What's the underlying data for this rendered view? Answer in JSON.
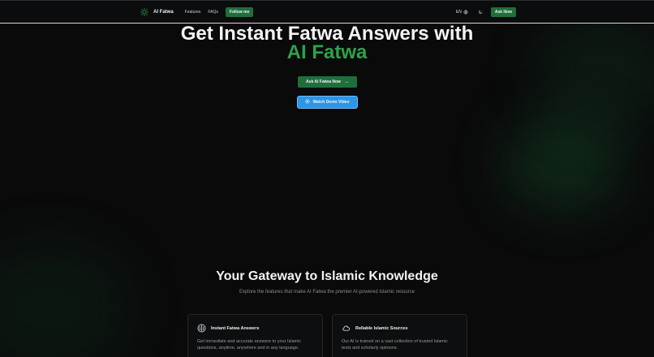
{
  "navbar": {
    "brand": "AI Fatwa",
    "links": [
      "Features",
      "FAQs"
    ],
    "follow_label": "Follow me",
    "lang": "EN",
    "ask_label": "Ask Now"
  },
  "hero": {
    "title_line1": "Get Instant Fatwa Answers with",
    "title_line2": "AI Fatwa",
    "primary_label": "Ask AI Fatwa Now",
    "demo_label": "Watch Demo Video"
  },
  "section": {
    "title": "Your Gateway to Islamic Knowledge",
    "subtitle": "Explore the features that make AI Fatwa the premier AI-powered Islamic resource",
    "cards": [
      {
        "title": "Instant Fatwa Answers",
        "desc": "Get immediate and accurate answers to your Islamic questions, anytime, anywhere and in any language.",
        "icon": "brain-icon"
      },
      {
        "title": "Reliable Islamic Sources",
        "desc": "Our AI is trained on a vast collection of trusted Islamic texts and scholarly opinions.",
        "icon": "cloud-icon"
      }
    ]
  },
  "colors": {
    "accent_green": "#1f6f3c",
    "title_green": "#2ca24a",
    "demo_blue": "#2b95e8",
    "background": "#0a0a0b"
  }
}
